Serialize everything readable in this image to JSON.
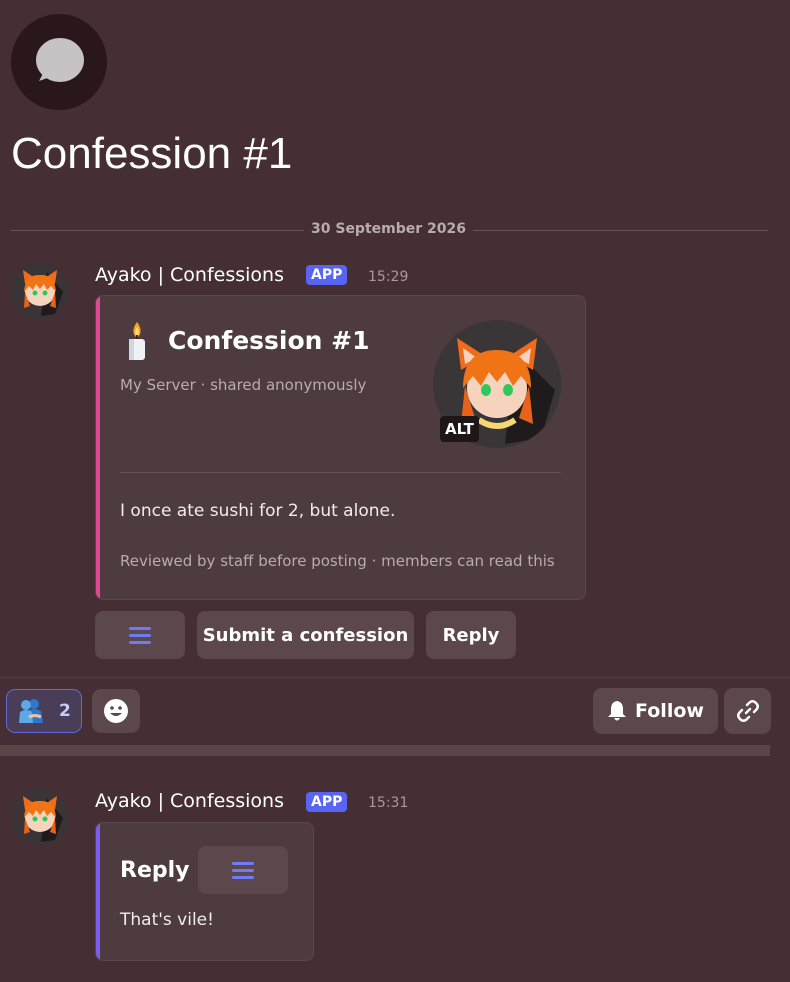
{
  "thread": {
    "title": "Confession #1",
    "date_divider": "30 September 2026",
    "icon": "speech-bubble-icon"
  },
  "messages": [
    {
      "author": "Ayako | Confessions",
      "badge": "APP",
      "time": "15:29",
      "embed": {
        "accent_color": "#e0488f",
        "icon": "candle-icon",
        "title": "Confession #1",
        "subtitle": "My Server · shared anonymously",
        "thumbnail_alt_badge": "ALT",
        "body": "I once ate sushi for 2, but alone.",
        "footer": "Reviewed by staff before posting ·  members can read this"
      },
      "buttons": {
        "menu_icon": "menu-icon",
        "submit_label": "Submit a confession",
        "reply_label": "Reply"
      }
    },
    {
      "author": "Ayako | Confessions",
      "badge": "APP",
      "time": "15:31",
      "embed": {
        "accent_color": "#7a5cf0",
        "title": "Reply",
        "body": "That's vile!",
        "menu_icon": "menu-icon"
      }
    }
  ],
  "reactions": [
    {
      "emoji": "hugging-people-icon",
      "count": "2"
    }
  ],
  "actions": {
    "add_reaction_icon": "smiley-icon",
    "follow_label": "Follow",
    "follow_icon": "bell-icon",
    "copy_link_icon": "link-icon"
  },
  "colors": {
    "background": "#452f34",
    "blurple": "#5865f2",
    "confession_accent": "#e0488f",
    "reply_accent": "#7a5cf0"
  }
}
